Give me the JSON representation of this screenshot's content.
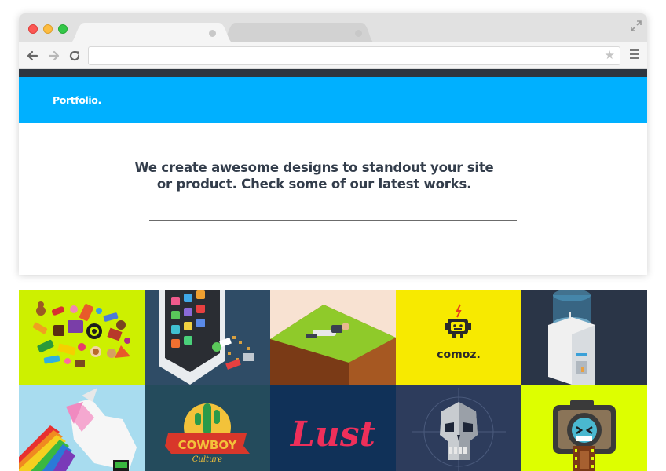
{
  "browser": {
    "address_value": "",
    "icons": {
      "back": "arrow-left-icon",
      "forward": "arrow-right-icon",
      "reload": "reload-icon",
      "bookmark": "star-icon",
      "menu": "hamburger-menu-icon",
      "expand": "expand-icon"
    }
  },
  "header": {
    "logo": "Portfolio.",
    "bg_color": "#00b0ff"
  },
  "intro": {
    "line1": "We create awesome designs to standout your site",
    "line2": "or product. Check some of our latest works."
  },
  "portfolio": {
    "tiles": [
      {
        "id": "candy",
        "bg": "#cdf000"
      },
      {
        "id": "phone",
        "bg": "#2f4c66"
      },
      {
        "id": "hill",
        "bg": "#f8e2d2"
      },
      {
        "id": "comoz",
        "bg": "#f7ea00",
        "text": "comoz."
      },
      {
        "id": "cooler",
        "bg": "#2a3547"
      },
      {
        "id": "unicorn",
        "bg": "#a8dcef"
      },
      {
        "id": "cowboy",
        "bg": "#244b5c",
        "text1": "COWBOY",
        "text2": "Culture"
      },
      {
        "id": "lust",
        "bg": "#103158",
        "text": "Lust"
      },
      {
        "id": "skull",
        "bg": "#2d3c5c"
      },
      {
        "id": "camera",
        "bg": "#ddff00"
      }
    ]
  }
}
